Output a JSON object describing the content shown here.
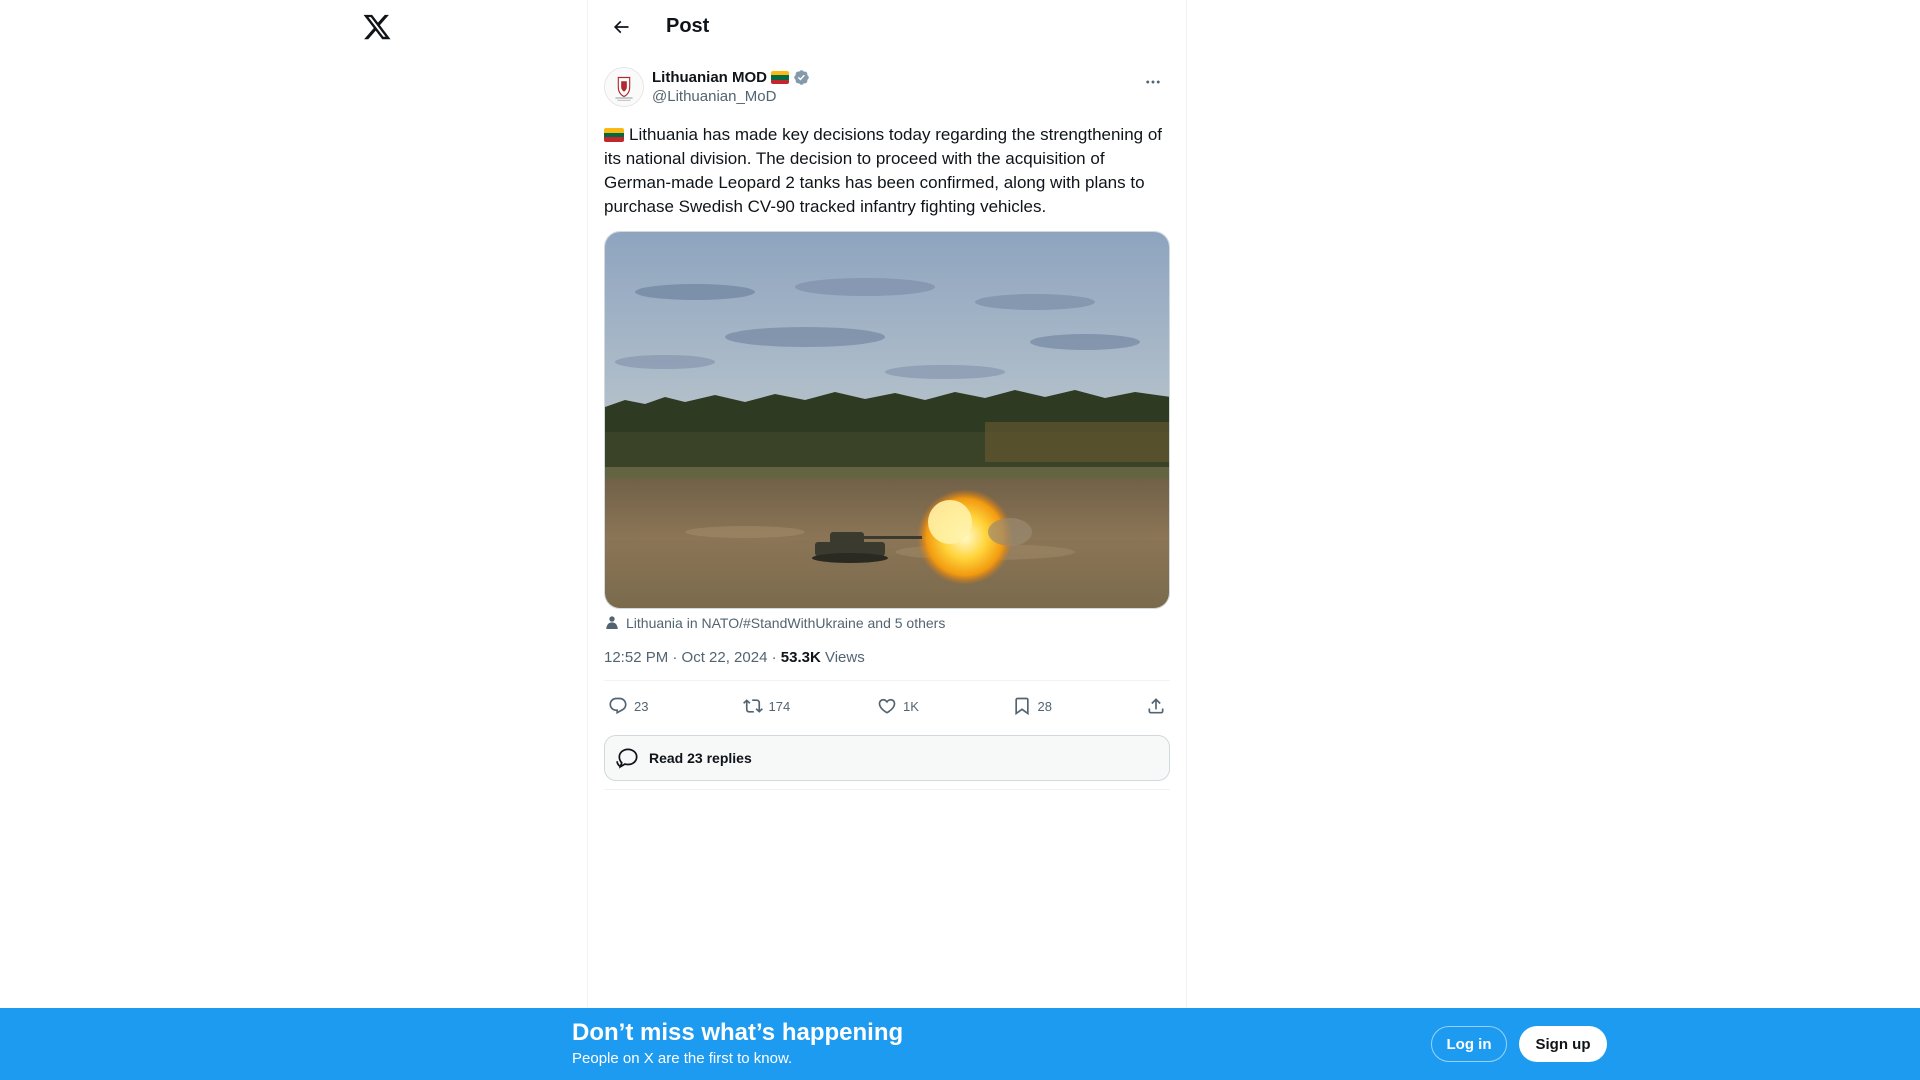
{
  "header": {
    "title": "Post"
  },
  "post": {
    "author_name": "Lithuanian MOD",
    "author_handle": "@Lithuanian_MoD",
    "text": "Lithuania has made key decisions today regarding the strengthening of its national division. The decision to proceed with the acquisition of German-made Leopard 2 tanks has been confirmed, along with plans to purchase Swedish CV-90 tracked infantry fighting vehicles.",
    "tagged": "Lithuania in NATO/#StandWithUkraine and 5 others",
    "time": "12:52 PM · Oct 22, 2024 · ",
    "views_count": "53.3K",
    "views_label": " Views",
    "stats": {
      "replies": "23",
      "reposts": "174",
      "likes": "1K",
      "bookmarks": "28"
    },
    "read_replies": "Read 23 replies"
  },
  "banner": {
    "title": "Don’t miss what’s happening",
    "subtitle": "People on X are the first to know.",
    "login": "Log in",
    "signup": "Sign up"
  },
  "colors": {
    "accent": "#1d9bf0",
    "verified": "#829aab",
    "secondary_text": "#536471",
    "flag_yellow": "#fdb913",
    "flag_green": "#006a44",
    "flag_red": "#c1272d"
  },
  "icons": [
    "x-logo-icon",
    "back-arrow-icon",
    "verified-badge-icon",
    "more-icon",
    "person-icon",
    "reply-icon",
    "repost-icon",
    "like-icon",
    "bookmark-icon",
    "share-icon",
    "chat-bubbles-icon"
  ]
}
